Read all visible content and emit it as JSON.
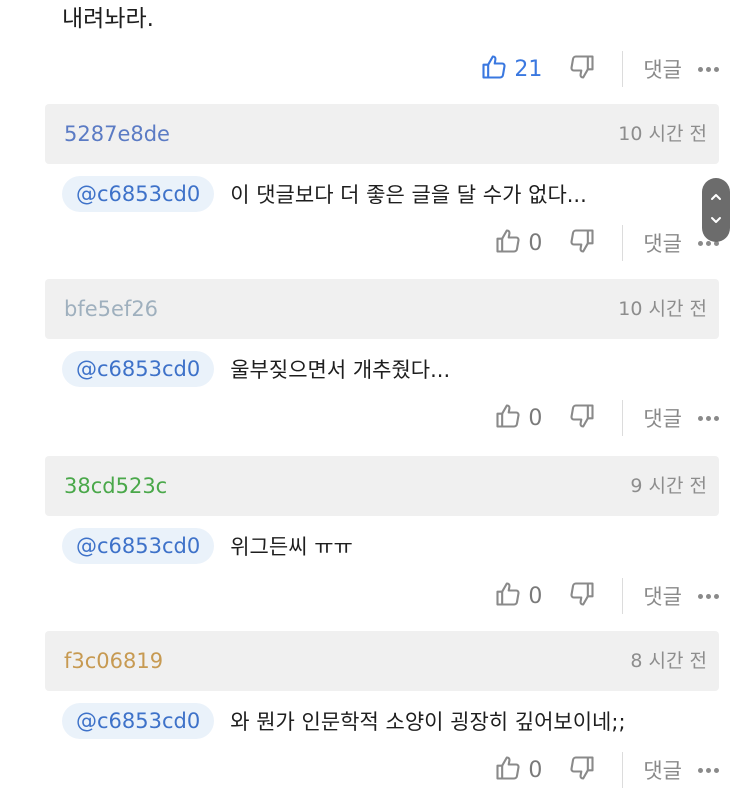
{
  "top_comment": {
    "text": "내려놔라.",
    "like_count": "21",
    "reply_label": "댓글"
  },
  "colors": {
    "like_active": "#3a78e0",
    "mention_bg": "#eaf2fa",
    "mention_text": "#3e72c9",
    "header_bg": "#f0f0f0"
  },
  "comments": [
    {
      "author": "5287e8de",
      "author_color": "#5b7bc4",
      "time": "10 시간 전",
      "mention": "@c6853cd0",
      "text": "이 댓글보다 더 좋은 글을 달 수가 없다...",
      "like_count": "0",
      "reply_label": "댓글"
    },
    {
      "author": "bfe5ef26",
      "author_color": "#9fb0be",
      "time": "10 시간 전",
      "mention": "@c6853cd0",
      "text": "울부짖으면서 개추줬다...",
      "like_count": "0",
      "reply_label": "댓글"
    },
    {
      "author": "38cd523c",
      "author_color": "#4aa84a",
      "time": "9 시간 전",
      "mention": "@c6853cd0",
      "text": "위그든씨 ㅠㅠ",
      "like_count": "0",
      "reply_label": "댓글"
    },
    {
      "author": "f3c06819",
      "author_color": "#c79a52",
      "time": "8 시간 전",
      "mention": "@c6853cd0",
      "text": "와 뭔가 인문학적 소양이 굉장히 깊어보이네;;",
      "like_count": "0",
      "reply_label": "댓글"
    }
  ],
  "icons": {
    "like": "thumbs-up-icon",
    "dislike": "thumbs-down-icon",
    "more": "more-dots-icon",
    "scroll_up": "chevron-up-icon",
    "scroll_down": "chevron-down-icon"
  }
}
